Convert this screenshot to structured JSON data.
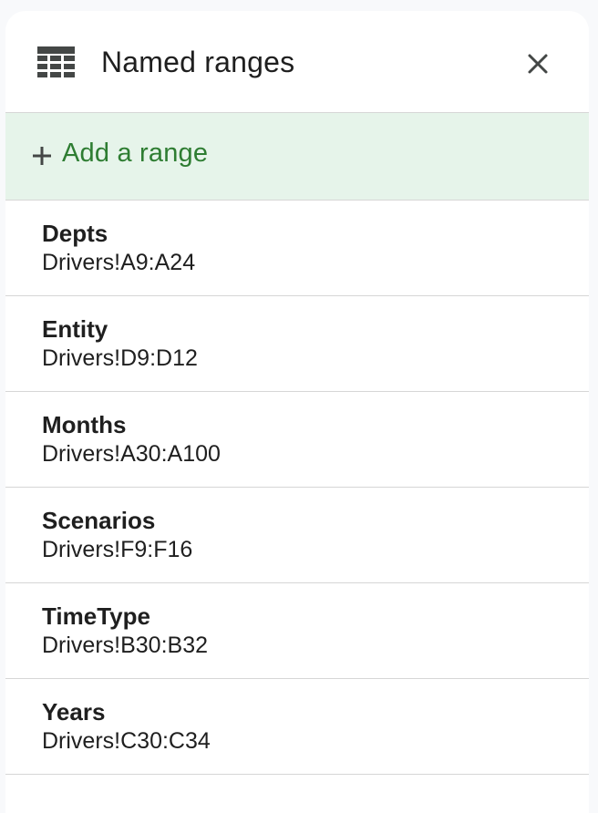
{
  "panel": {
    "title": "Named ranges",
    "icons": {
      "header": "table-icon",
      "close": "close-icon",
      "add": "plus-icon"
    },
    "add_label": "Add a range",
    "colors": {
      "add_background": "#e6f4ea",
      "add_text": "#2e7d32",
      "divider": "#d6d6d6"
    }
  },
  "ranges": [
    {
      "name": "Depts",
      "ref": "Drivers!A9:A24"
    },
    {
      "name": "Entity",
      "ref": "Drivers!D9:D12"
    },
    {
      "name": "Months",
      "ref": "Drivers!A30:A100"
    },
    {
      "name": "Scenarios",
      "ref": "Drivers!F9:F16"
    },
    {
      "name": "TimeType",
      "ref": "Drivers!B30:B32"
    },
    {
      "name": "Years",
      "ref": "Drivers!C30:C34"
    }
  ]
}
